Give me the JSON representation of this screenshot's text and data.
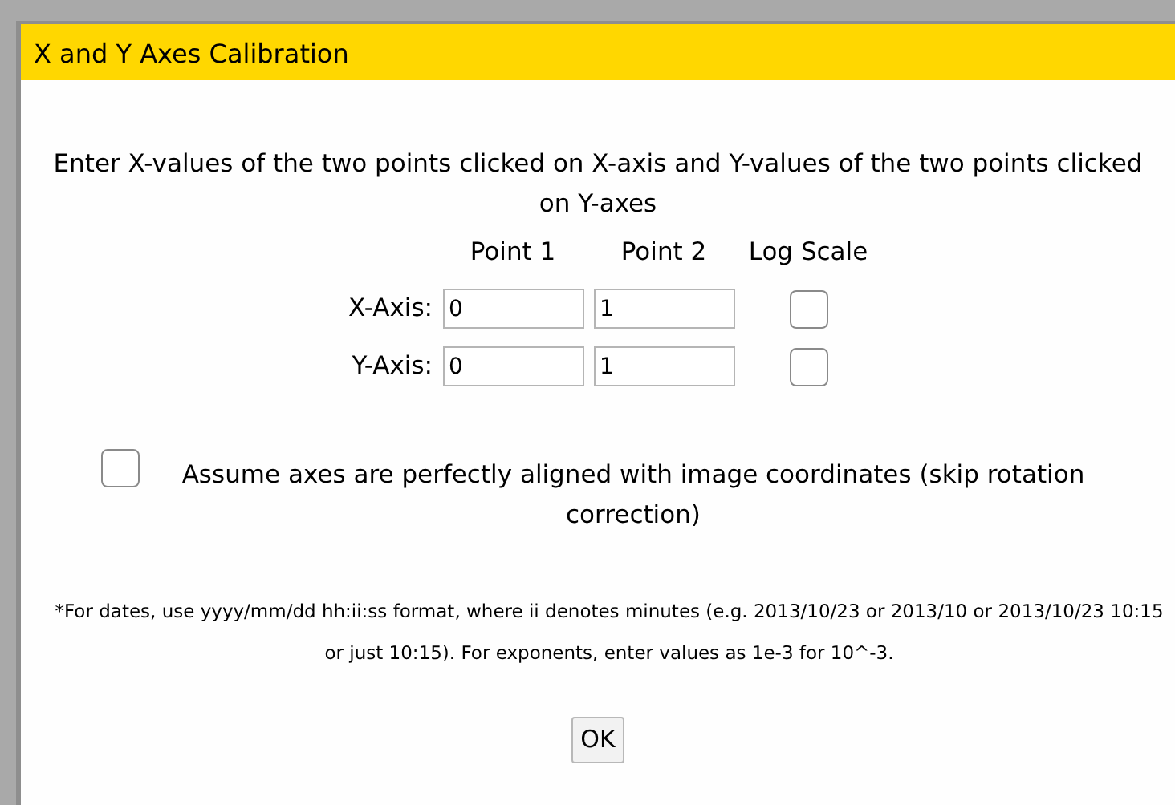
{
  "dialog": {
    "title": "X and Y Axes Calibration",
    "instructions": "Enter X-values of the two points clicked on X-axis and Y-values of the two points clicked on Y-axes",
    "columns": [
      "Point 1",
      "Point 2",
      "Log Scale"
    ],
    "axes": [
      {
        "label": "X-Axis:",
        "point_1": "0",
        "point_2": "1",
        "log_scale": false
      },
      {
        "label": "Y-Axis:",
        "point_1": "0",
        "point_2": "1",
        "log_scale": false
      }
    ],
    "skip_rotation": {
      "label": "Assume axes are perfectly aligned with image coordinates (skip rotation correction)",
      "checked": false
    },
    "note": "*For dates, use yyyy/mm/dd hh:ii:ss format, where ii denotes minutes (e.g. 2013/10/23 or 2013/10 or 2013/10/23 10:15 or just 10:15). For exponents, enter values as 1e-3 for 10^-3.",
    "ok_button": "OK"
  }
}
